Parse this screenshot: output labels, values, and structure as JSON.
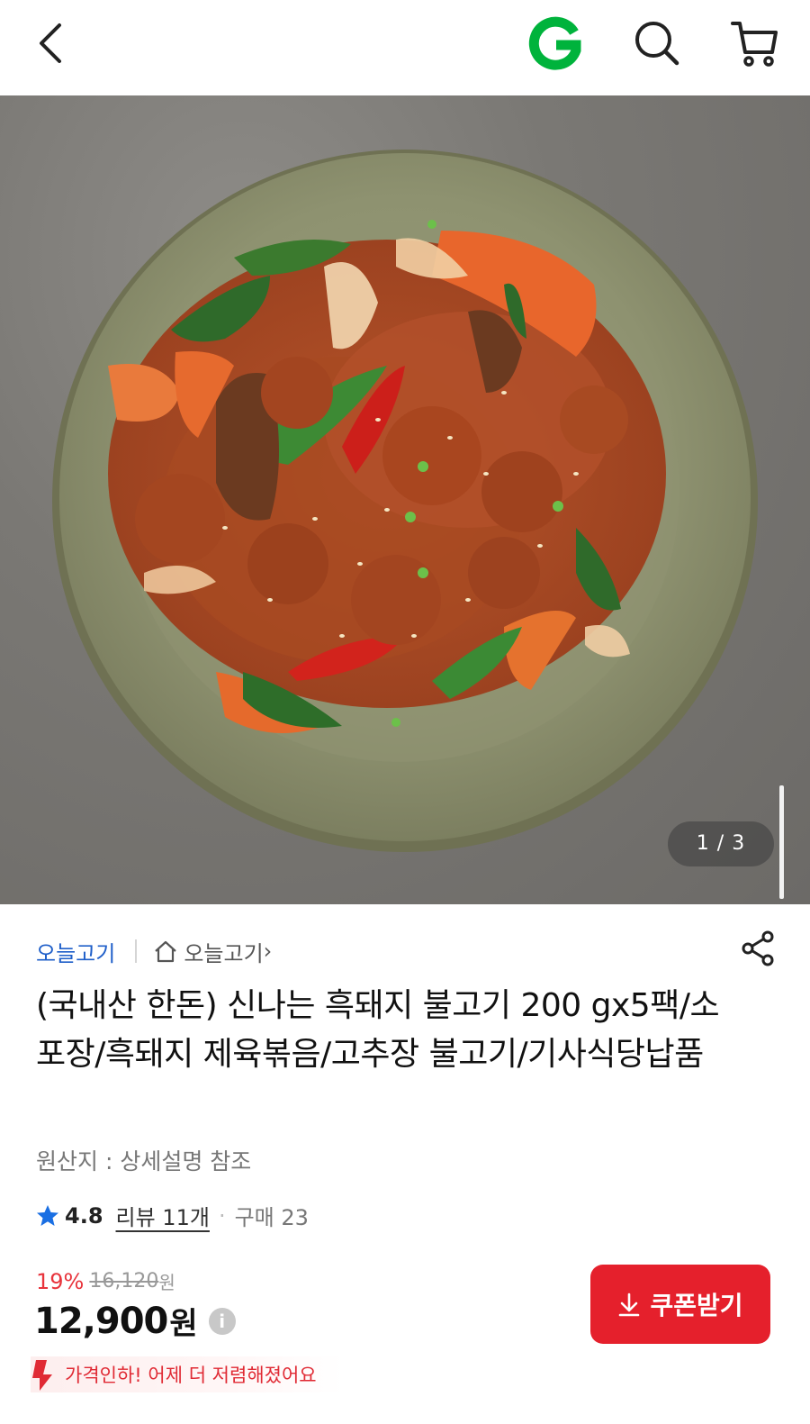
{
  "header": {
    "back_icon": "chevron-left-icon",
    "logo_letter": "G",
    "logo_color": "#00b33c",
    "search_icon": "search-icon",
    "cart_icon": "cart-icon"
  },
  "gallery": {
    "image_alt": "제육볶음 (pork bulgogi) on green ceramic plate",
    "counter": "1 / 3"
  },
  "seller": {
    "name": "오늘고기",
    "store_label": "오늘고기",
    "store_arrow": "›"
  },
  "product": {
    "title": "(국내산 한돈) 신나는 흑돼지 불고기 200 gx5팩/소포장/흑돼지 제육볶음/고추장 불고기/기사식당납품",
    "origin": "원산지 : 상세설명 참조"
  },
  "rating": {
    "score": "4.8",
    "review_label": "리뷰 11개",
    "separator": "·",
    "purchase_label": "구매 23"
  },
  "price": {
    "discount": "19%",
    "original": "16,120",
    "original_unit": "원",
    "current": "12,900",
    "current_unit": "원",
    "info_glyph": "i"
  },
  "price_drop": {
    "text": "가격인하! 어제 더 저렴해졌어요"
  },
  "coupon": {
    "label": "쿠폰받기"
  },
  "colors": {
    "accent_red": "#e5202c",
    "seller_blue": "#1f5fc9",
    "star_blue": "#1a6fe3"
  }
}
